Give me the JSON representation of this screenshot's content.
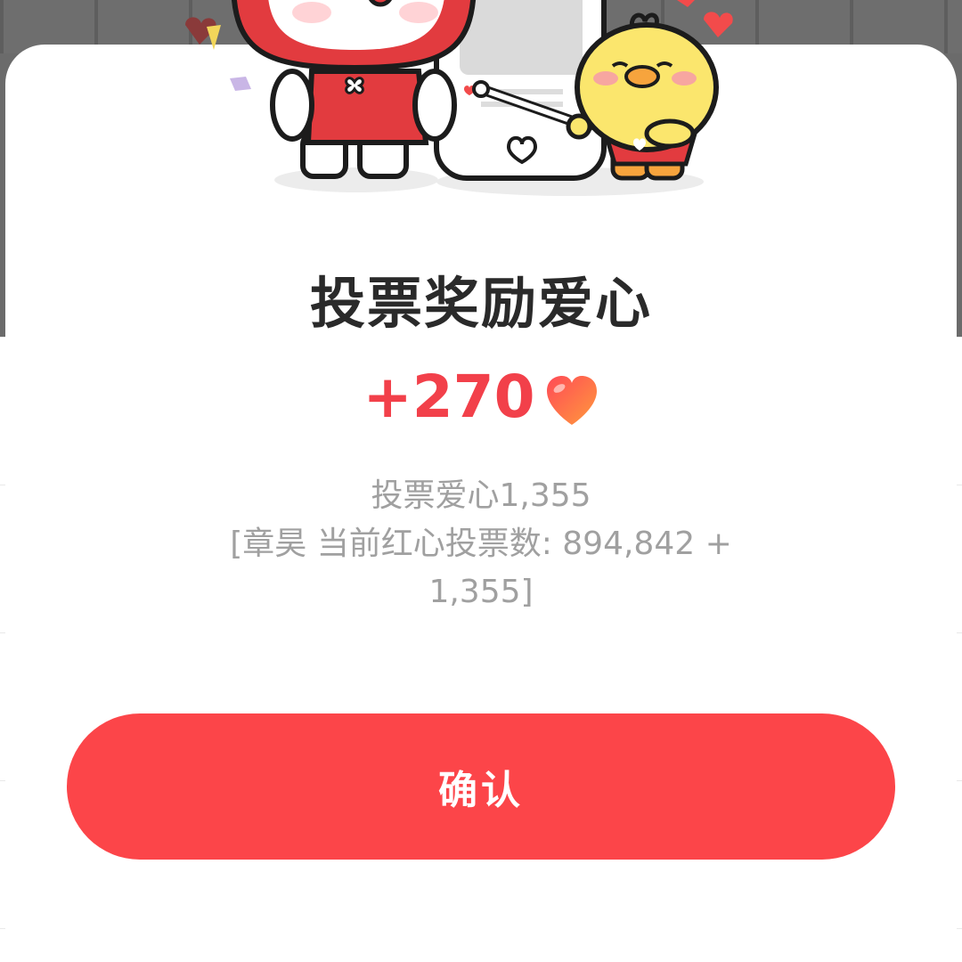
{
  "dialog": {
    "title": "投票奖励爱心",
    "reward_amount": "+270",
    "detail_line1": "投票爱心1,355",
    "detail_line2": "[章昊 当前红心投票数: 894,842 +\n1,355]",
    "confirm_label": "确认"
  },
  "icons": {
    "reward_heart": "heart-icon"
  },
  "colors": {
    "accent": "#fc4549",
    "reward_text": "#f2404a",
    "title_text": "#2a2a2a",
    "detail_text": "#a0a0a0"
  }
}
